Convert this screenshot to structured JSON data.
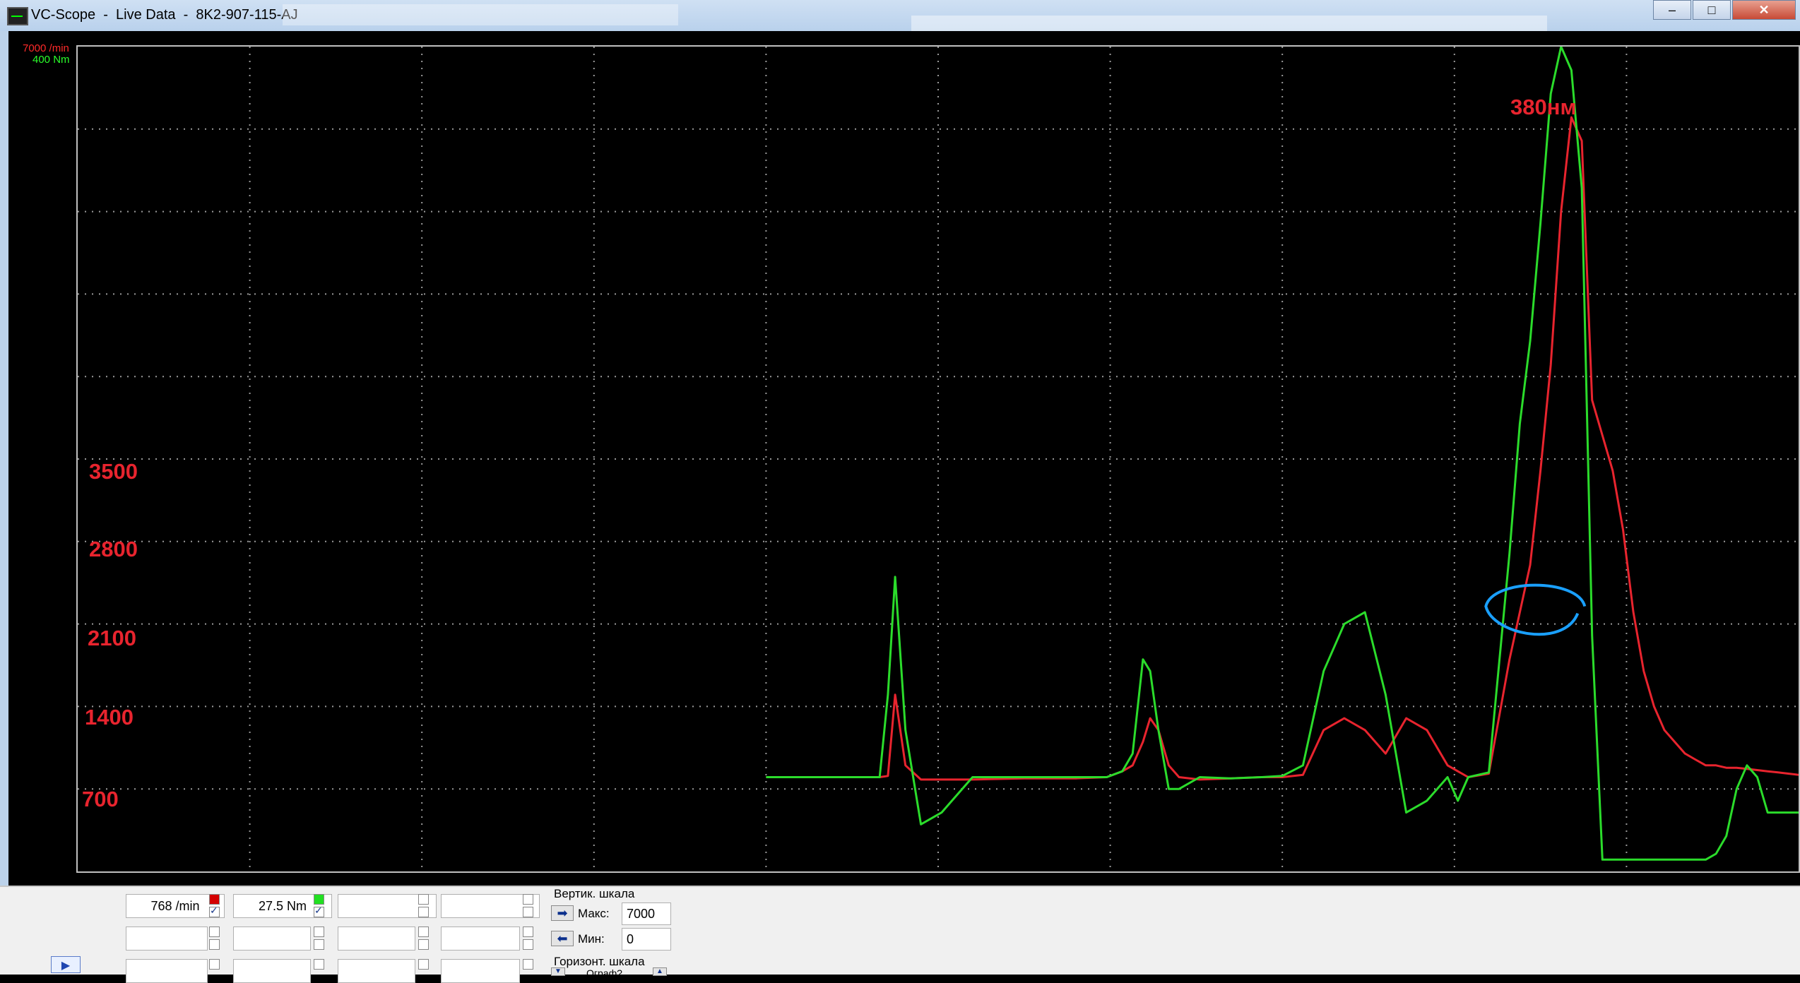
{
  "window": {
    "title": "VC-Scope  -  Live Data  -  8K2-907-115-AJ",
    "buttons": [
      "–",
      "□",
      "✕"
    ]
  },
  "scope": {
    "axis_max_rpm": "7000 /min",
    "axis_max_torque": "400 Nm",
    "colors": {
      "rpm": "#e8242e",
      "torque": "#2bdc2b",
      "grid": "#9a9a9a",
      "annotation_circle": "#1aa0ff"
    },
    "annotations": {
      "rpm_700": "700",
      "rpm_1400": "1400",
      "rpm_2100": "2100",
      "rpm_2800": "2800",
      "rpm_3500": "3500",
      "peak_torque": "380нм"
    }
  },
  "chart_data": {
    "type": "line",
    "ylim": [
      0,
      7000
    ],
    "x": [
      0.0,
      0.1,
      0.11,
      0.118,
      0.125,
      0.135,
      0.15,
      0.17,
      0.2,
      0.25,
      0.3,
      0.33,
      0.345,
      0.355,
      0.365,
      0.372,
      0.38,
      0.39,
      0.4,
      0.42,
      0.45,
      0.48,
      0.5,
      0.52,
      0.54,
      0.56,
      0.58,
      0.6,
      0.62,
      0.64,
      0.66,
      0.67,
      0.68,
      0.7,
      0.72,
      0.73,
      0.74,
      0.75,
      0.76,
      0.77,
      0.78,
      0.79,
      0.8,
      0.81,
      0.82,
      0.83,
      0.84,
      0.85,
      0.86,
      0.87,
      0.88,
      0.89,
      0.9,
      0.91,
      0.92,
      0.93,
      0.94,
      0.95,
      0.96,
      0.97,
      0.98,
      0.99,
      1.0
    ],
    "series": [
      {
        "name": "7000 /min",
        "values": [
          800,
          800,
          800,
          810,
          1500,
          900,
          780,
          780,
          780,
          790,
          790,
          800,
          850,
          900,
          1100,
          1300,
          1200,
          900,
          800,
          780,
          790,
          800,
          800,
          820,
          1200,
          1300,
          1200,
          1000,
          1300,
          1200,
          900,
          850,
          800,
          830,
          1800,
          2200,
          2600,
          3400,
          4300,
          5600,
          6400,
          6200,
          4000,
          3700,
          3400,
          2900,
          2200,
          1700,
          1400,
          1200,
          1100,
          1000,
          950,
          900,
          900,
          880,
          880,
          870,
          860,
          850,
          840,
          830,
          820
        ]
      },
      {
        "name": "400 Nm",
        "values": [
          800,
          800,
          800,
          1500,
          2500,
          1200,
          400,
          500,
          800,
          800,
          800,
          800,
          850,
          1000,
          1800,
          1700,
          1200,
          700,
          700,
          800,
          790,
          800,
          810,
          900,
          1700,
          2100,
          2200,
          1500,
          500,
          600,
          800,
          600,
          800,
          840,
          2700,
          3800,
          4500,
          5500,
          6600,
          7000,
          6800,
          5800,
          2000,
          100,
          100,
          100,
          100,
          100,
          100,
          100,
          100,
          100,
          100,
          100,
          150,
          300,
          700,
          900,
          800,
          500,
          500,
          500,
          500
        ]
      }
    ],
    "grid": true
  },
  "panel": {
    "channels": [
      {
        "value": "768 /min",
        "color": "red",
        "checked": true
      },
      {
        "value": "27.5 Nm",
        "color": "green",
        "checked": true
      },
      {
        "value": "",
        "color": "none",
        "checked": false
      },
      {
        "value": "",
        "color": "none",
        "checked": false
      }
    ],
    "vertical_scale": {
      "title": "Вертик. шкала",
      "max_label": "Макс:",
      "max_value": "7000",
      "min_label": "Мин:",
      "min_value": "0"
    },
    "horizontal_scale": {
      "title": "Горизонт. шкала",
      "partial_label": "Ограф?"
    }
  }
}
